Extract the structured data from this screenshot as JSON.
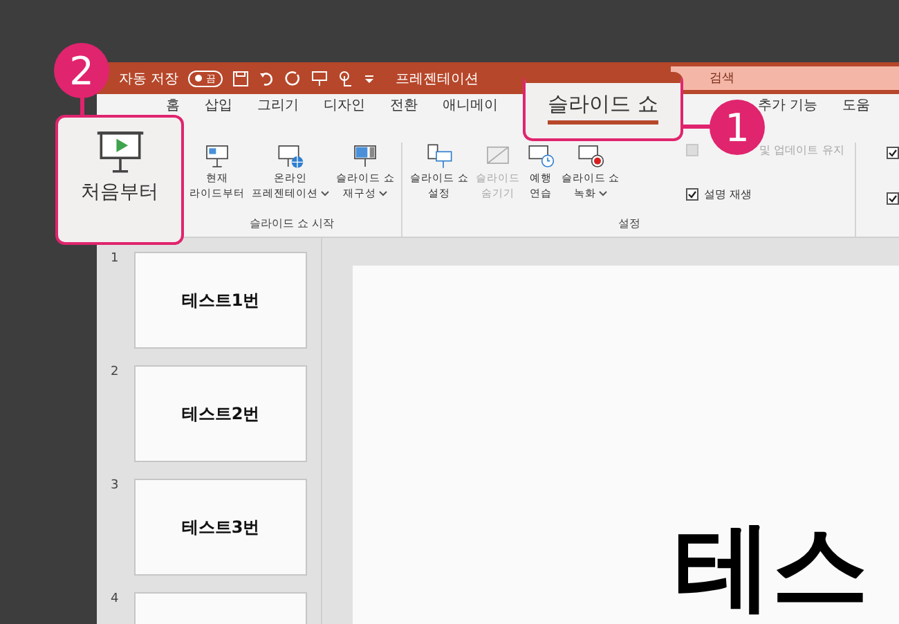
{
  "title_bar": {
    "autosave_label": "자동 저장",
    "autosave_toggle": {
      "label": "끔",
      "on": false
    },
    "document_title": "프레젠테이션",
    "search_placeholder": "검색"
  },
  "tabs": [
    {
      "label": "홈",
      "selected": false
    },
    {
      "label": "삽입",
      "selected": false
    },
    {
      "label": "그리기",
      "selected": false
    },
    {
      "label": "디자인",
      "selected": false
    },
    {
      "label": "전환",
      "selected": false
    },
    {
      "label": "애니메이",
      "selected": false
    },
    {
      "label": "추가 기능",
      "selected": false
    },
    {
      "label": "도움",
      "selected": false
    }
  ],
  "ribbon_groups": [
    {
      "label": "슬라이드 쇼 시작",
      "buttons": [
        {
          "kind": "current",
          "lines": [
            "현재",
            "라이드부터"
          ],
          "dropdown": false,
          "disabled": false
        },
        {
          "kind": "online",
          "lines": [
            "온라인",
            "프레젠테이션"
          ],
          "dropdown": true,
          "disabled": false
        },
        {
          "kind": "custom",
          "lines": [
            "슬라이드 쇼",
            "재구성"
          ],
          "dropdown": true,
          "disabled": false
        }
      ]
    },
    {
      "label": "설정",
      "buttons": [
        {
          "kind": "setup",
          "lines": [
            "슬라이드 쇼",
            "설정"
          ],
          "dropdown": false,
          "disabled": false
        },
        {
          "kind": "hide",
          "lines": [
            "슬라이드",
            "숨기기"
          ],
          "dropdown": false,
          "disabled": true
        },
        {
          "kind": "rehearse",
          "lines": [
            "예행",
            "연습"
          ],
          "dropdown": false,
          "disabled": false
        },
        {
          "kind": "record",
          "lines": [
            "슬라이드 쇼",
            "녹화"
          ],
          "dropdown": true,
          "disabled": false
        }
      ],
      "checkboxes": [
        {
          "label": "및 업데이트 유지",
          "checked": false,
          "disabled": true
        },
        {
          "label": "설명 재생",
          "checked": true,
          "disabled": false
        }
      ]
    }
  ],
  "edge_checkboxes": [
    {
      "checked": true
    },
    {
      "checked": true
    }
  ],
  "slides": [
    {
      "number": "1",
      "title": "테스트1번"
    },
    {
      "number": "2",
      "title": "테스트2번"
    },
    {
      "number": "3",
      "title": "테스트3번"
    },
    {
      "number": "4"
    }
  ],
  "main_slide": {
    "title": "테스"
  },
  "callouts": [
    {
      "number": "2",
      "kind": "button",
      "label": "처음부터"
    },
    {
      "number": "1",
      "kind": "tab",
      "label": "슬라이드 쇼"
    }
  ]
}
